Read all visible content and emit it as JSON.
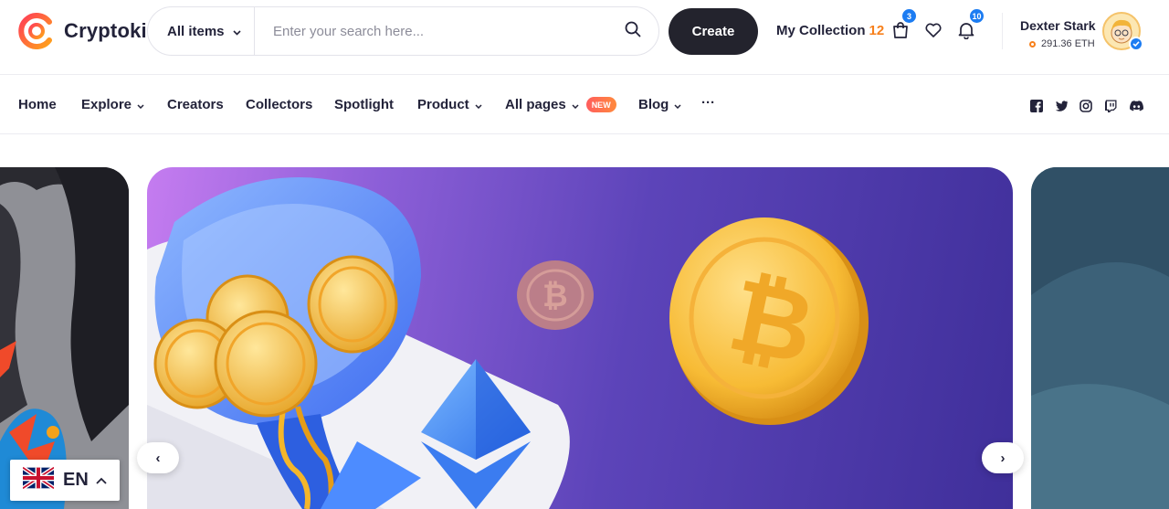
{
  "brand": {
    "name": "Cryptoki",
    "accent": "#f7801c",
    "gradient_start": "#ff4d4d"
  },
  "search": {
    "category": "All items",
    "placeholder": "Enter your search here...",
    "value": ""
  },
  "header": {
    "create_label": "Create",
    "collection_label": "My Collection",
    "collection_count": "12",
    "cart_count": "3",
    "notification_count": "10",
    "icons": [
      "cart-icon",
      "heart-icon",
      "bell-icon",
      "search-icon"
    ]
  },
  "user": {
    "name": "Dexter Stark",
    "balance": "291.36 ETH",
    "verified": true
  },
  "nav": {
    "items": [
      {
        "label": "Home",
        "dropdown": false
      },
      {
        "label": "Explore",
        "dropdown": true
      },
      {
        "label": "Creators",
        "dropdown": false
      },
      {
        "label": "Collectors",
        "dropdown": false
      },
      {
        "label": "Spotlight",
        "dropdown": false
      },
      {
        "label": "Product",
        "dropdown": true
      },
      {
        "label": "All pages",
        "dropdown": true,
        "badge": "NEW"
      },
      {
        "label": "Blog",
        "dropdown": true
      },
      {
        "label": "···",
        "dropdown": false
      }
    ],
    "social": [
      "facebook-icon",
      "twitter-icon",
      "instagram-icon",
      "twitch-icon",
      "discord-icon"
    ]
  },
  "carousel": {
    "prev_label": "‹",
    "next_label": "›"
  },
  "language": {
    "code": "EN",
    "flag": "uk-flag-icon"
  },
  "colors": {
    "dark": "#23232d",
    "badge_blue": "#1c7cf2",
    "banner_purple": "#5c44b9"
  }
}
